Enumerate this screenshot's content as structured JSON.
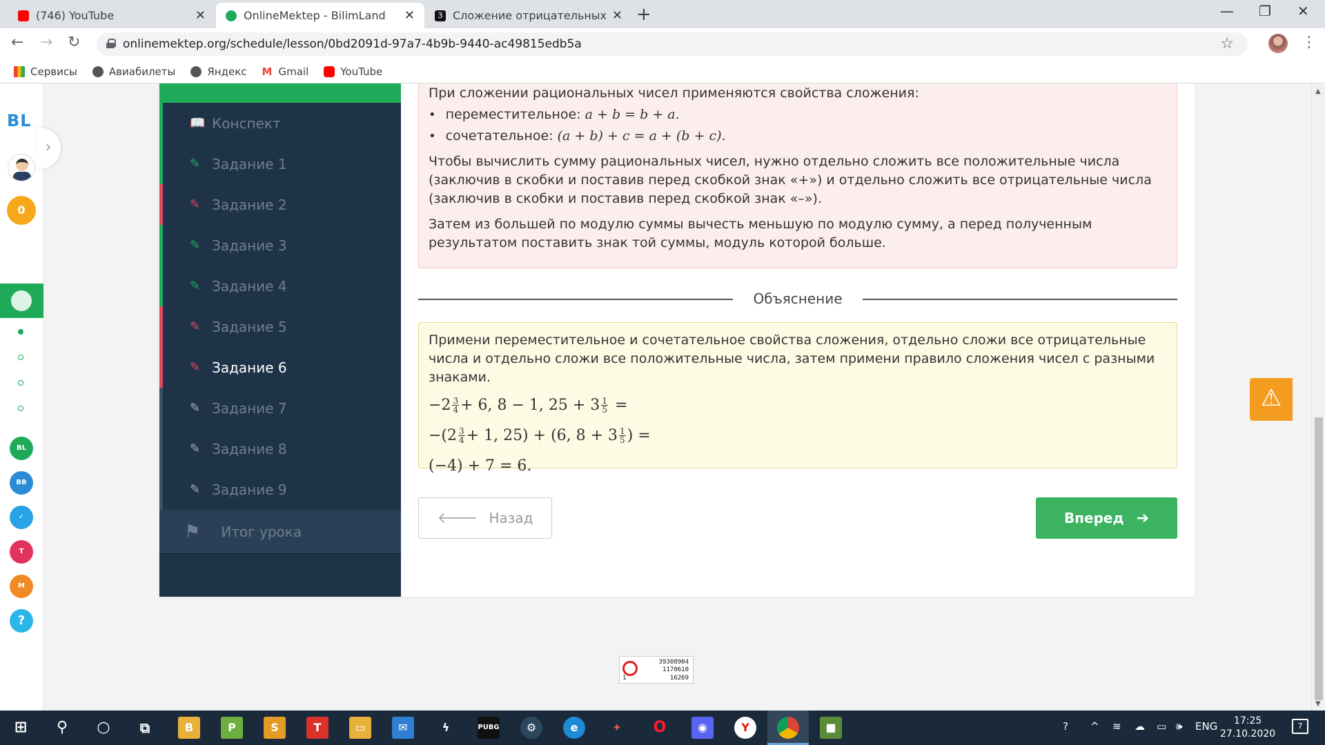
{
  "browser": {
    "tabs": [
      {
        "title": "(746) YouTube",
        "active": false
      },
      {
        "title": "OnlineMektep - BilimLand",
        "active": true
      },
      {
        "title": "Сложение отрицательных рац",
        "active": false
      }
    ],
    "url": "onlinemektep.org/schedule/lesson/0bd2091d-97a7-4b9b-9440-ac49815edb5a",
    "bookmarks": [
      "Сервисы",
      "Авиабилеты",
      "Яндекс",
      "Gmail",
      "YouTube"
    ]
  },
  "rail": {
    "logo": "BL",
    "coins": "0"
  },
  "sidebar": {
    "items": [
      {
        "label": "Конспект",
        "status": "done"
      },
      {
        "label": "Задание 1",
        "status": "done"
      },
      {
        "label": "Задание 2",
        "status": "wrong"
      },
      {
        "label": "Задание 3",
        "status": "done"
      },
      {
        "label": "Задание 4",
        "status": "done"
      },
      {
        "label": "Задание 5",
        "status": "wrong"
      },
      {
        "label": "Задание 6",
        "status": "current"
      },
      {
        "label": "Задание 7",
        "status": "todo"
      },
      {
        "label": "Задание 8",
        "status": "todo"
      },
      {
        "label": "Задание 9",
        "status": "todo"
      }
    ],
    "result": "Итог урока"
  },
  "theory": {
    "intro": "При сложении рациональных чисел применяются свойства сложения:",
    "bullet1_label": "переместительное:",
    "bullet1_formula": "a + b = b + a.",
    "bullet2_label": "сочетательное:",
    "bullet2_formula": "(a + b) + c = a + (b + c).",
    "para1": "Чтобы вычислить сумму рациональных чисел, нужно отдельно сложить все положительные числа (заключив в скобки и поставив перед скобкой знак «+») и отдельно сложить все отрицательные числа (заключив в скобки и поставив перед скобкой знак «–»).",
    "para2": "Затем из большей по модулю суммы вычесть меньшую по модулю сумму, а перед полученным результатом поставить знак той суммы, модуль которой больше."
  },
  "explanation": {
    "heading": "Объяснение",
    "text": "Примени переместительное и сочетательное свойства сложения, отдельно сложи все отрицательные числа и отдельно сложи все положительные числа, затем примени правило сложения чисел с разными знаками.",
    "eq1_a": "−2",
    "eq1_b": "+ 6, 8 − 1, 25 + 3",
    "eq1_c": "=",
    "eq2_a": "−(2",
    "eq2_b": "+ 1, 25) + (6, 8 + 3",
    "eq2_c": ") =",
    "eq3": "(−4) + 7 = 6.",
    "frac_3_4": {
      "num": "3",
      "den": "4"
    },
    "frac_1_5": {
      "num": "1",
      "den": "5"
    }
  },
  "buttons": {
    "back": "Назад",
    "next": "Вперед"
  },
  "counter": {
    "line1": "39308904",
    "line2": "1170610",
    "line3": "16269",
    "line4": "1"
  },
  "taskbar": {
    "lang": "ENG",
    "time": "17:25",
    "date": "27.10.2020",
    "notifications": "7"
  },
  "colors": {
    "accent_green": "#1dab5a",
    "wrong_red": "#e0475b",
    "sidebar_bg": "#1f3348",
    "warning": "#f39c1f"
  }
}
